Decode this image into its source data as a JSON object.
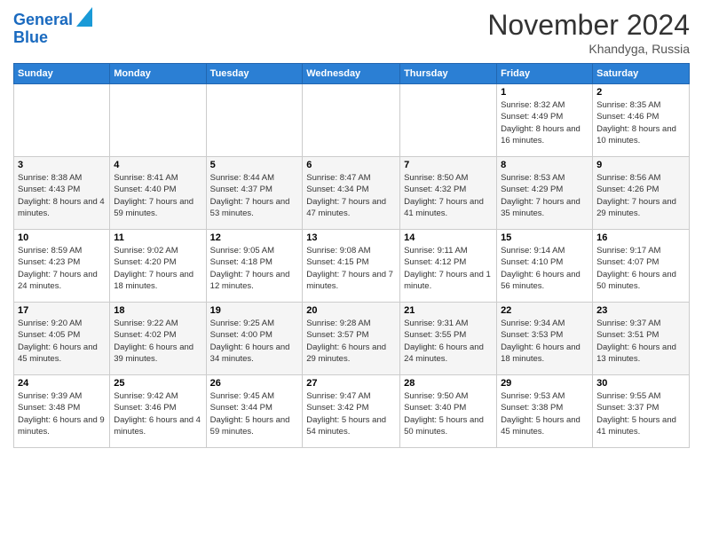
{
  "logo": {
    "line1": "General",
    "line2": "Blue"
  },
  "header": {
    "month": "November 2024",
    "location": "Khandyga, Russia"
  },
  "weekdays": [
    "Sunday",
    "Monday",
    "Tuesday",
    "Wednesday",
    "Thursday",
    "Friday",
    "Saturday"
  ],
  "weeks": [
    [
      {
        "day": "",
        "info": ""
      },
      {
        "day": "",
        "info": ""
      },
      {
        "day": "",
        "info": ""
      },
      {
        "day": "",
        "info": ""
      },
      {
        "day": "",
        "info": ""
      },
      {
        "day": "1",
        "info": "Sunrise: 8:32 AM\nSunset: 4:49 PM\nDaylight: 8 hours and 16 minutes."
      },
      {
        "day": "2",
        "info": "Sunrise: 8:35 AM\nSunset: 4:46 PM\nDaylight: 8 hours and 10 minutes."
      }
    ],
    [
      {
        "day": "3",
        "info": "Sunrise: 8:38 AM\nSunset: 4:43 PM\nDaylight: 8 hours and 4 minutes."
      },
      {
        "day": "4",
        "info": "Sunrise: 8:41 AM\nSunset: 4:40 PM\nDaylight: 7 hours and 59 minutes."
      },
      {
        "day": "5",
        "info": "Sunrise: 8:44 AM\nSunset: 4:37 PM\nDaylight: 7 hours and 53 minutes."
      },
      {
        "day": "6",
        "info": "Sunrise: 8:47 AM\nSunset: 4:34 PM\nDaylight: 7 hours and 47 minutes."
      },
      {
        "day": "7",
        "info": "Sunrise: 8:50 AM\nSunset: 4:32 PM\nDaylight: 7 hours and 41 minutes."
      },
      {
        "day": "8",
        "info": "Sunrise: 8:53 AM\nSunset: 4:29 PM\nDaylight: 7 hours and 35 minutes."
      },
      {
        "day": "9",
        "info": "Sunrise: 8:56 AM\nSunset: 4:26 PM\nDaylight: 7 hours and 29 minutes."
      }
    ],
    [
      {
        "day": "10",
        "info": "Sunrise: 8:59 AM\nSunset: 4:23 PM\nDaylight: 7 hours and 24 minutes."
      },
      {
        "day": "11",
        "info": "Sunrise: 9:02 AM\nSunset: 4:20 PM\nDaylight: 7 hours and 18 minutes."
      },
      {
        "day": "12",
        "info": "Sunrise: 9:05 AM\nSunset: 4:18 PM\nDaylight: 7 hours and 12 minutes."
      },
      {
        "day": "13",
        "info": "Sunrise: 9:08 AM\nSunset: 4:15 PM\nDaylight: 7 hours and 7 minutes."
      },
      {
        "day": "14",
        "info": "Sunrise: 9:11 AM\nSunset: 4:12 PM\nDaylight: 7 hours and 1 minute."
      },
      {
        "day": "15",
        "info": "Sunrise: 9:14 AM\nSunset: 4:10 PM\nDaylight: 6 hours and 56 minutes."
      },
      {
        "day": "16",
        "info": "Sunrise: 9:17 AM\nSunset: 4:07 PM\nDaylight: 6 hours and 50 minutes."
      }
    ],
    [
      {
        "day": "17",
        "info": "Sunrise: 9:20 AM\nSunset: 4:05 PM\nDaylight: 6 hours and 45 minutes."
      },
      {
        "day": "18",
        "info": "Sunrise: 9:22 AM\nSunset: 4:02 PM\nDaylight: 6 hours and 39 minutes."
      },
      {
        "day": "19",
        "info": "Sunrise: 9:25 AM\nSunset: 4:00 PM\nDaylight: 6 hours and 34 minutes."
      },
      {
        "day": "20",
        "info": "Sunrise: 9:28 AM\nSunset: 3:57 PM\nDaylight: 6 hours and 29 minutes."
      },
      {
        "day": "21",
        "info": "Sunrise: 9:31 AM\nSunset: 3:55 PM\nDaylight: 6 hours and 24 minutes."
      },
      {
        "day": "22",
        "info": "Sunrise: 9:34 AM\nSunset: 3:53 PM\nDaylight: 6 hours and 18 minutes."
      },
      {
        "day": "23",
        "info": "Sunrise: 9:37 AM\nSunset: 3:51 PM\nDaylight: 6 hours and 13 minutes."
      }
    ],
    [
      {
        "day": "24",
        "info": "Sunrise: 9:39 AM\nSunset: 3:48 PM\nDaylight: 6 hours and 9 minutes."
      },
      {
        "day": "25",
        "info": "Sunrise: 9:42 AM\nSunset: 3:46 PM\nDaylight: 6 hours and 4 minutes."
      },
      {
        "day": "26",
        "info": "Sunrise: 9:45 AM\nSunset: 3:44 PM\nDaylight: 5 hours and 59 minutes."
      },
      {
        "day": "27",
        "info": "Sunrise: 9:47 AM\nSunset: 3:42 PM\nDaylight: 5 hours and 54 minutes."
      },
      {
        "day": "28",
        "info": "Sunrise: 9:50 AM\nSunset: 3:40 PM\nDaylight: 5 hours and 50 minutes."
      },
      {
        "day": "29",
        "info": "Sunrise: 9:53 AM\nSunset: 3:38 PM\nDaylight: 5 hours and 45 minutes."
      },
      {
        "day": "30",
        "info": "Sunrise: 9:55 AM\nSunset: 3:37 PM\nDaylight: 5 hours and 41 minutes."
      }
    ]
  ]
}
